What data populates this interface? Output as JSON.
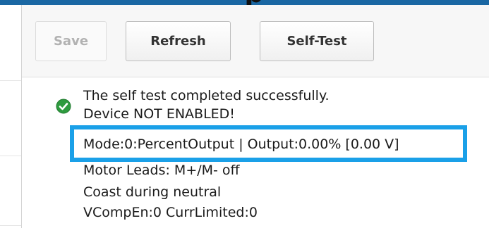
{
  "header": {
    "title": "p"
  },
  "toolbar": {
    "save_label": "Save",
    "refresh_label": "Refresh",
    "self_test_label": "Self-Test"
  },
  "status": {
    "icon": "check-circle-icon",
    "lines": [
      "The self test completed successfully.",
      "Device NOT ENABLED!",
      "Mode:0:PercentOutput | Output:0.00% [0.00 V]",
      "Motor Leads: M+/M- off",
      "Coast during neutral",
      "VCompEn:0 CurrLimited:0"
    ]
  },
  "colors": {
    "top_bar": "#1a67a3",
    "highlight": "#1aa0e8",
    "success": "#2e9a3f"
  }
}
